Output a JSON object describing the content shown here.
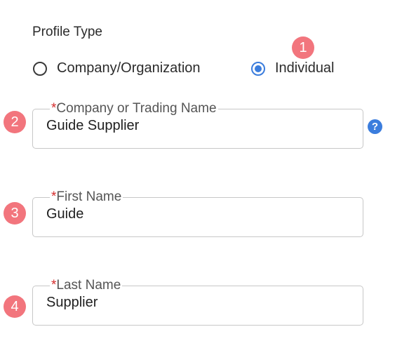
{
  "profile_type": {
    "label": "Profile Type",
    "options": [
      {
        "label": "Company/Organization",
        "selected": false
      },
      {
        "label": "Individual",
        "selected": true
      }
    ]
  },
  "fields": [
    {
      "required_mark": "*",
      "label": "Company or Trading Name",
      "value": "Guide Supplier",
      "help_icon": "question-circle-icon"
    },
    {
      "required_mark": "*",
      "label": "First Name",
      "value": "Guide"
    },
    {
      "required_mark": "*",
      "label": "Last Name",
      "value": "Supplier"
    }
  ],
  "badges": [
    "1",
    "2",
    "3",
    "4"
  ],
  "help_icon": {
    "glyph": "?"
  },
  "colors": {
    "accent": "#3b7ddd",
    "badge": "#f2757d",
    "required": "#d42b2b",
    "border": "#c7c7c7"
  }
}
